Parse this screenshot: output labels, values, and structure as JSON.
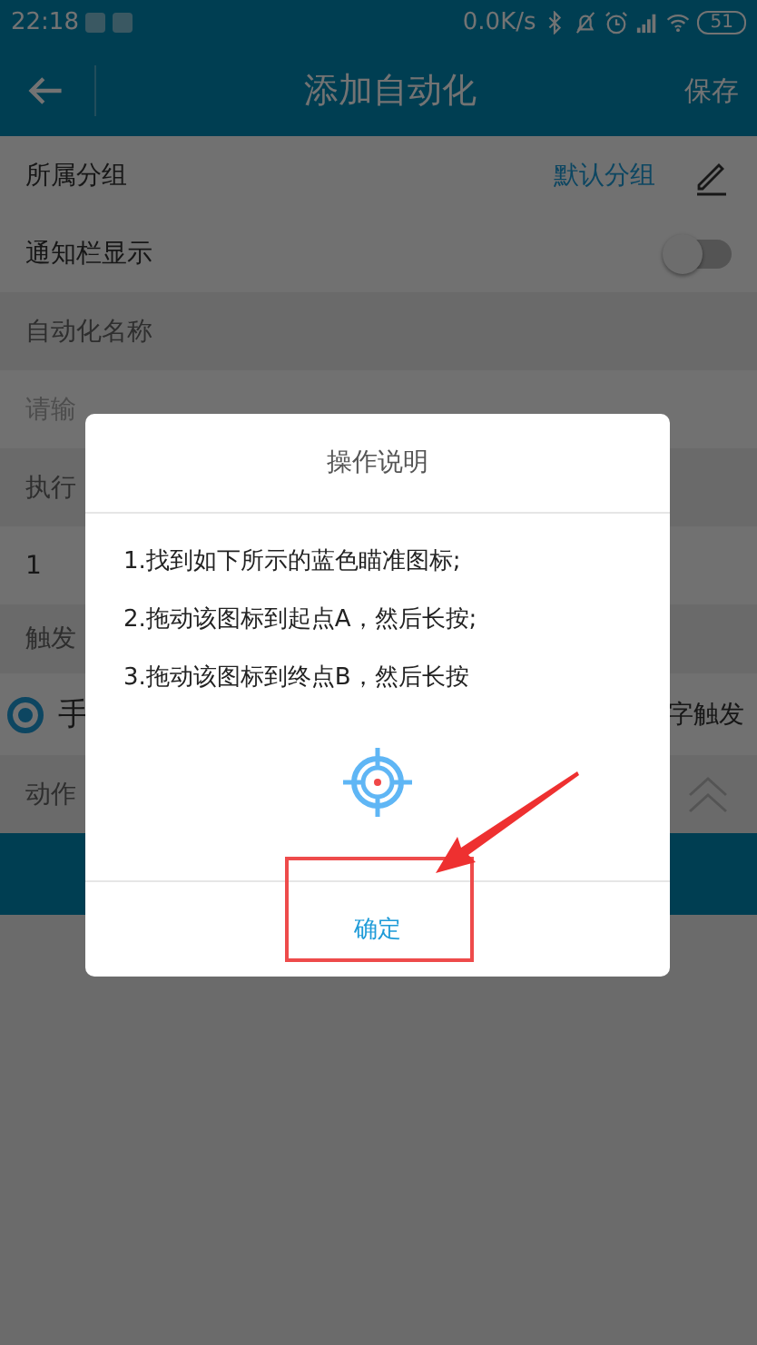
{
  "status_bar": {
    "time": "22:18",
    "net_speed": "0.0K/s",
    "battery": "51"
  },
  "app_bar": {
    "title": "添加自动化",
    "action": "保存"
  },
  "form": {
    "group": {
      "label": "所属分组",
      "value": "默认分组"
    },
    "notify": {
      "label": "通知栏显示",
      "on": false
    },
    "name_label": "自动化名称",
    "name_field": {
      "placeholder": "请输"
    },
    "exec_label": "执行",
    "exec_value": "1",
    "trigger_label": "触发",
    "manual_trigger": {
      "label": "手",
      "selected": true
    },
    "other_trigger": {
      "label": "字触发"
    },
    "action_label": "动作"
  },
  "dialog": {
    "title": "操作说明",
    "steps": [
      "1.找到如下所示的蓝色瞄准图标;",
      "2.拖动该图标到起点A，然后长按;",
      "3.拖动该图标到终点B，然后长按"
    ],
    "button": "确定"
  }
}
